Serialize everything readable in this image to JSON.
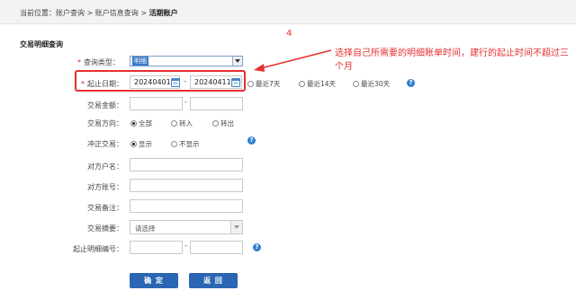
{
  "breadcrumb": {
    "prefix": "当前位置：",
    "item1": "账户查询",
    "sep1": " > ",
    "item2": "账户信息查询",
    "sep2": " > ",
    "current": "活期账户"
  },
  "section_title": "交易明细查询",
  "form": {
    "query_type": {
      "label": "查询类型：",
      "value": "明细"
    },
    "date_range": {
      "label": "起止日期：",
      "start": "20240401",
      "end": "20240411",
      "separator": "-",
      "quick_options": [
        "最近7天",
        "最近14天",
        "最近30天"
      ]
    },
    "amount": {
      "label": "交易金额：",
      "separator": "-"
    },
    "direction": {
      "label": "交易方向：",
      "options": [
        "全部",
        "转入",
        "转出"
      ],
      "selected": "全部"
    },
    "reversal": {
      "label": "冲正交易：",
      "options": [
        "显示",
        "不显示"
      ],
      "selected": "显示"
    },
    "counterparty_name": {
      "label": "对方户名："
    },
    "counterparty_account": {
      "label": "对方账号："
    },
    "remark": {
      "label": "交易备注："
    },
    "summary": {
      "label": "交易摘要：",
      "placeholder": "请选择"
    },
    "detail_no": {
      "label": "起止明细编号：",
      "separator": "-"
    },
    "required_mark": "*"
  },
  "buttons": {
    "confirm": "确 定",
    "back": "返 回"
  },
  "help_icon_glyph": "?",
  "annotation": {
    "number": "4",
    "text": "选择自己所需要的明细账单时间，建行的起止时间不超过三个月",
    "color": "#e53030"
  },
  "colors": {
    "accent": "#2a66b3",
    "annotation": "#e53030"
  }
}
